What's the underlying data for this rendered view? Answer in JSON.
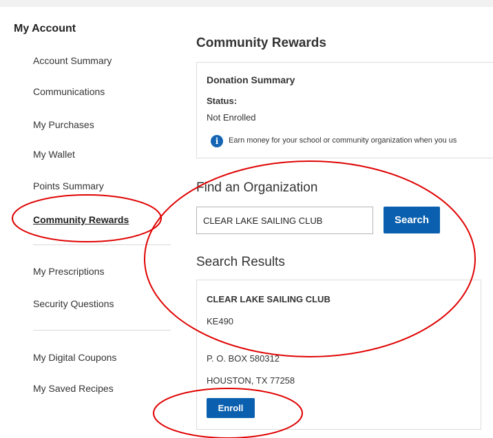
{
  "sidebar": {
    "title": "My Account",
    "items": [
      {
        "label": "Account Summary"
      },
      {
        "label": "Communications"
      },
      {
        "label": "My Purchases"
      },
      {
        "label": "My Wallet"
      },
      {
        "label": "Points Summary"
      },
      {
        "label": "Community Rewards",
        "active": true
      },
      {
        "label": "My Prescriptions"
      },
      {
        "label": "Security Questions"
      },
      {
        "label": "My Digital Coupons"
      },
      {
        "label": "My Saved Recipes"
      }
    ]
  },
  "main": {
    "title": "Community Rewards",
    "donation_summary": {
      "title": "Donation Summary",
      "status_label": "Status:",
      "status_value": "Not Enrolled",
      "info_icon": "info-icon",
      "info_text": "Earn money for your school or community organization when you us"
    },
    "find_org": {
      "title": "Find an Organization",
      "search_value": "CLEAR LAKE SAILING CLUB",
      "search_button": "Search"
    },
    "results": {
      "title": "Search Results",
      "name": "CLEAR LAKE SAILING CLUB",
      "code": "KE490",
      "address1": "P. O. BOX 580312",
      "address2": "HOUSTON, TX 77258",
      "enroll_button": "Enroll"
    }
  },
  "colors": {
    "primary_button": "#0a5fae",
    "info_icon": "#1465b4",
    "annotation": "#e00000"
  }
}
